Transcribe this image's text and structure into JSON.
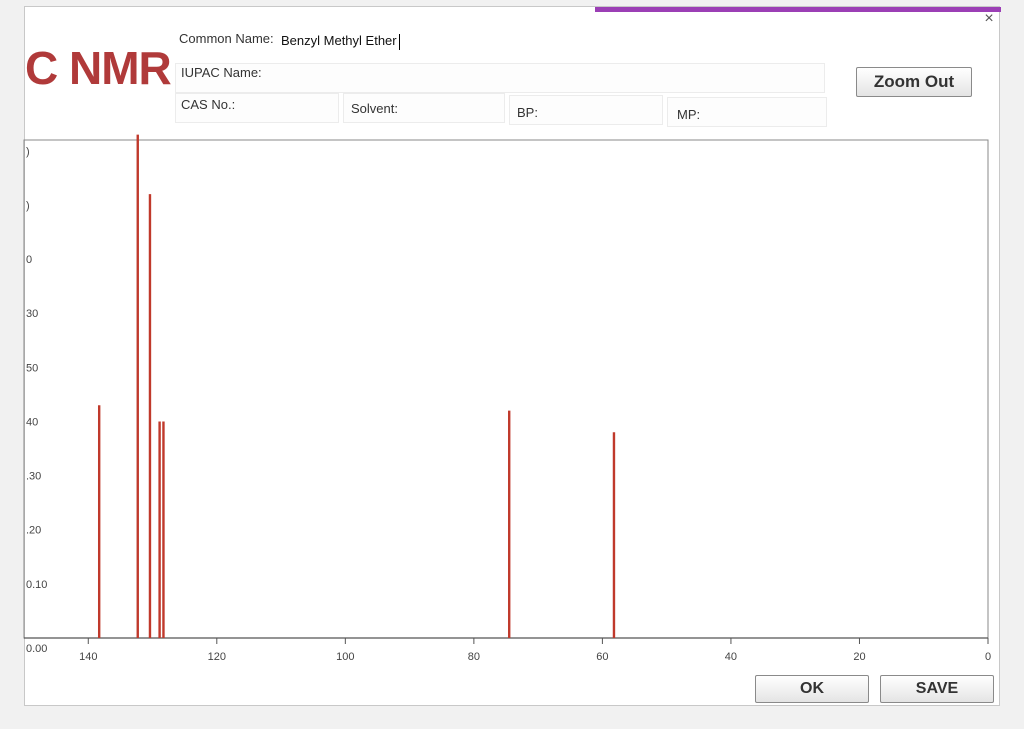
{
  "window": {
    "title": "C NMR",
    "close_glyph": "×"
  },
  "form": {
    "common_name_label": "Common Name:",
    "common_name_value": "Benzyl Methyl Ether",
    "iupac_label": "IUPAC Name:",
    "iupac_value": "",
    "cas_label": "CAS No.:",
    "cas_value": "",
    "solvent_label": "Solvent:",
    "solvent_value": "",
    "bp_label": "BP:",
    "bp_value": "",
    "mp_label": "MP:",
    "mp_value": ""
  },
  "buttons": {
    "zoom_out": "Zoom Out",
    "ok": "OK",
    "save": "SAVE"
  },
  "colors": {
    "peak": "#c0392b",
    "title": "#b03a3a",
    "accent": "#9b3fb5"
  },
  "chart_data": {
    "type": "bar",
    "xlim": [
      150,
      0
    ],
    "ylim": [
      0,
      0.92
    ],
    "x_ticks": [
      140,
      120,
      100,
      80,
      60,
      40,
      20,
      0
    ],
    "y_ticks": [
      {
        "value": 0.1,
        "label": "0.10"
      },
      {
        "value": 0.2,
        "label": ".20"
      },
      {
        "value": 0.3,
        "label": ".30"
      },
      {
        "value": 0.4,
        "label": "40"
      },
      {
        "value": 0.5,
        "label": "50"
      },
      {
        "value": 0.6,
        "label": "30"
      },
      {
        "value": 0.7,
        "label": "0"
      },
      {
        "value": 0.8,
        "label": ")"
      },
      {
        "value": 0.9,
        "label": ")"
      }
    ],
    "y_zero_label": "0.00",
    "peaks": [
      {
        "x": 138.3,
        "y": 0.43
      },
      {
        "x": 132.3,
        "y": 0.93
      },
      {
        "x": 130.4,
        "y": 0.82
      },
      {
        "x": 128.9,
        "y": 0.4
      },
      {
        "x": 128.3,
        "y": 0.4
      },
      {
        "x": 74.5,
        "y": 0.42
      },
      {
        "x": 58.2,
        "y": 0.38
      }
    ]
  }
}
